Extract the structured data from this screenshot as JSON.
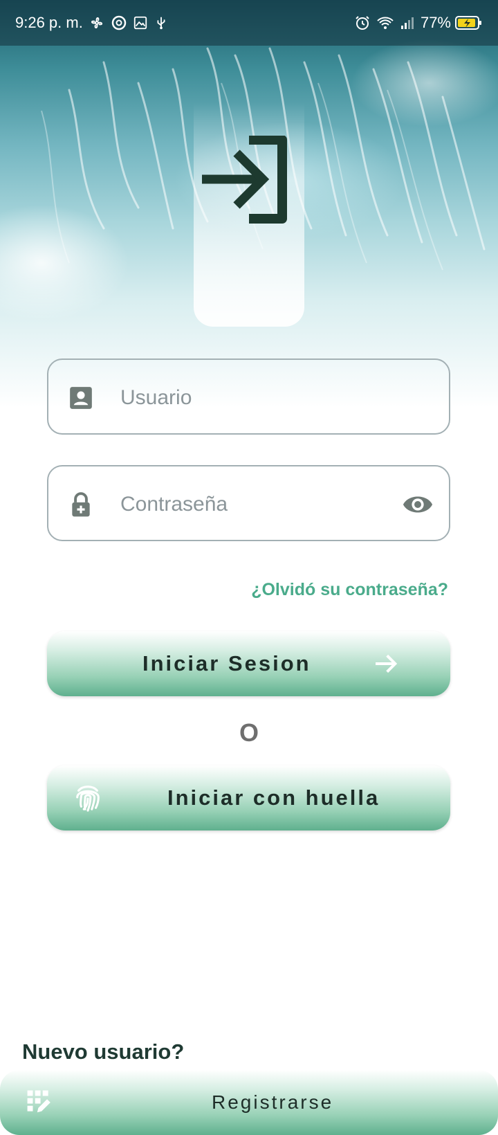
{
  "status_bar": {
    "time": "9:26 p. m.",
    "battery": "77%"
  },
  "login": {
    "username_placeholder": "Usuario",
    "password_placeholder": "Contraseña",
    "forgot_password": "¿Olvidó su contraseña?",
    "login_button": "Iniciar Sesion",
    "or_text": "O",
    "fingerprint_button": "Iniciar con huella"
  },
  "register": {
    "prompt": "Nuevo usuario?",
    "button": "Registrarse"
  },
  "colors": {
    "accent": "#4aab8b",
    "button_gradient_bottom": "#5fb08e",
    "text_dark": "#1f3a33"
  },
  "icons": {
    "logo": "login-arrow-icon",
    "username": "account-box-icon",
    "password": "lock-plus-icon",
    "visibility": "eye-icon",
    "login_arrow": "arrow-right-icon",
    "fingerprint": "fingerprint-icon",
    "register": "grid-edit-icon"
  }
}
